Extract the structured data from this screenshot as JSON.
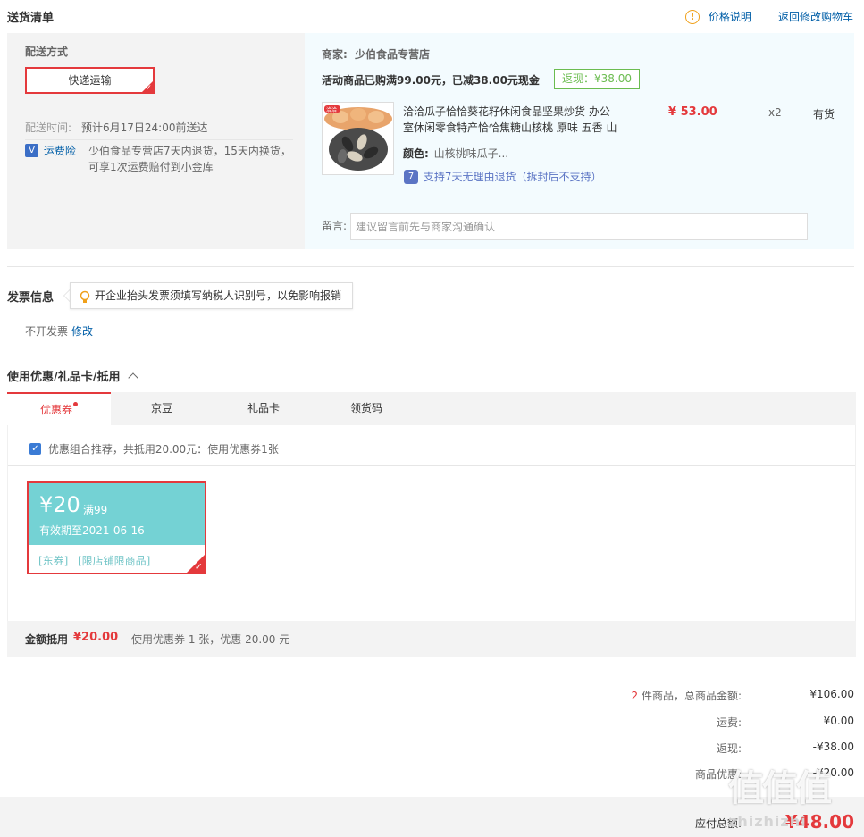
{
  "header": {
    "title": "送货清单",
    "price_note": "价格说明",
    "back_cart": "返回修改购物车"
  },
  "shipping": {
    "method_label": "配送方式",
    "method_btn": "快递运输",
    "time_label": "配送时间:",
    "time_value": "预计6月17日24:00前送达",
    "insure_label": "运费险",
    "insure_desc_1": "少伯食品专营店7天内退货，15天内换货，",
    "insure_desc_2": "可享1次运费赔付到小金库"
  },
  "store": {
    "label": "商家:",
    "name": "少伯食品专营店",
    "promo": "活动商品已购满99.00元，已减38.00元现金",
    "rebate": "返现：¥38.00"
  },
  "product": {
    "name_line1": "洽洽瓜子恰恰葵花籽休闲食品坚果炒货 办公",
    "name_line2": "室休闲零食特产恰恰焦糖山核桃 原味 五香 山",
    "price": "¥ 53.00",
    "qty": "x2",
    "stock": "有货",
    "color_label": "颜色:",
    "color_value": "山核桃味瓜子...",
    "support": "支持7天无理由退货（拆封后不支持）",
    "img_brand": "洽洽"
  },
  "message": {
    "label": "留言:",
    "placeholder": "建议留言前先与商家沟通确认"
  },
  "invoice": {
    "title": "发票信息",
    "tip": "开企业抬头发票须填写纳税人识别号，以免影响报销",
    "value": "不开发票",
    "edit": "修改"
  },
  "discount": {
    "title": "使用优惠/礼品卡/抵用",
    "tabs": [
      "优惠券",
      "京豆",
      "礼品卡",
      "领货码"
    ],
    "combo": "优惠组合推荐，共抵用20.00元：使用优惠券1张"
  },
  "coupon": {
    "amount": "¥20",
    "condition": "满99",
    "expiry": "有效期至2021-06-16",
    "tag1": "[东券]",
    "tag2": "[限店铺限商品]"
  },
  "summary": {
    "label": "金额抵用",
    "amount": "¥20.00",
    "desc": "使用优惠券 1 张，优惠 20.00 元"
  },
  "totals": {
    "count": "2",
    "count_suffix": "件商品，总商品金额:",
    "goods_total": "¥106.00",
    "freight_label": "运费:",
    "freight": "¥0.00",
    "rebate_label": "返现:",
    "rebate": "-¥38.00",
    "coupon_label": "商品优惠:",
    "coupon": "-¥20.00",
    "payable_label": "应付总额:",
    "payable": "¥48.00"
  },
  "watermark": {
    "big": "值值值",
    "small": "zhizhizhi"
  },
  "colors": {
    "accent": "#e4393c",
    "link": "#005ea7",
    "coupon": "#74d2d4",
    "rebate": "#6bbc50"
  }
}
